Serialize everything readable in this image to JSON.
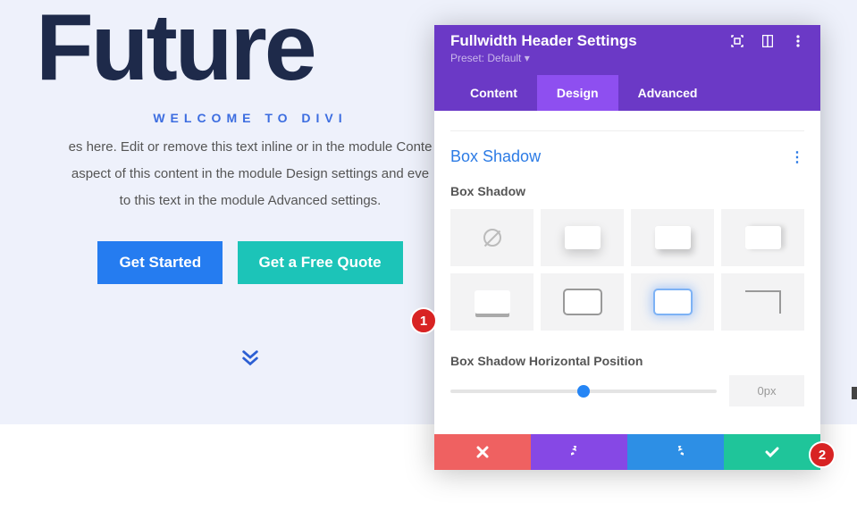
{
  "hero": {
    "title": "Future",
    "subtitle": "Welcome to Divi",
    "desc_l1": "es here. Edit or remove this text inline or in the module Conte",
    "desc_l2": "aspect of this content in the module Design settings and eve",
    "desc_l3": "to this text in the module Advanced settings.",
    "btn_primary": "Get Started",
    "btn_secondary": "Get a Free Quote"
  },
  "panel": {
    "title": "Fullwidth Header Settings",
    "preset": "Preset: Default ▾",
    "tabs": {
      "content": "Content",
      "design": "Design",
      "advanced": "Advanced"
    },
    "section_title": "Box Shadow",
    "field_label": "Box Shadow",
    "slider_label": "Box Shadow Horizontal Position",
    "slider_value": "0px"
  },
  "callouts": {
    "1": "1",
    "2": "2"
  }
}
